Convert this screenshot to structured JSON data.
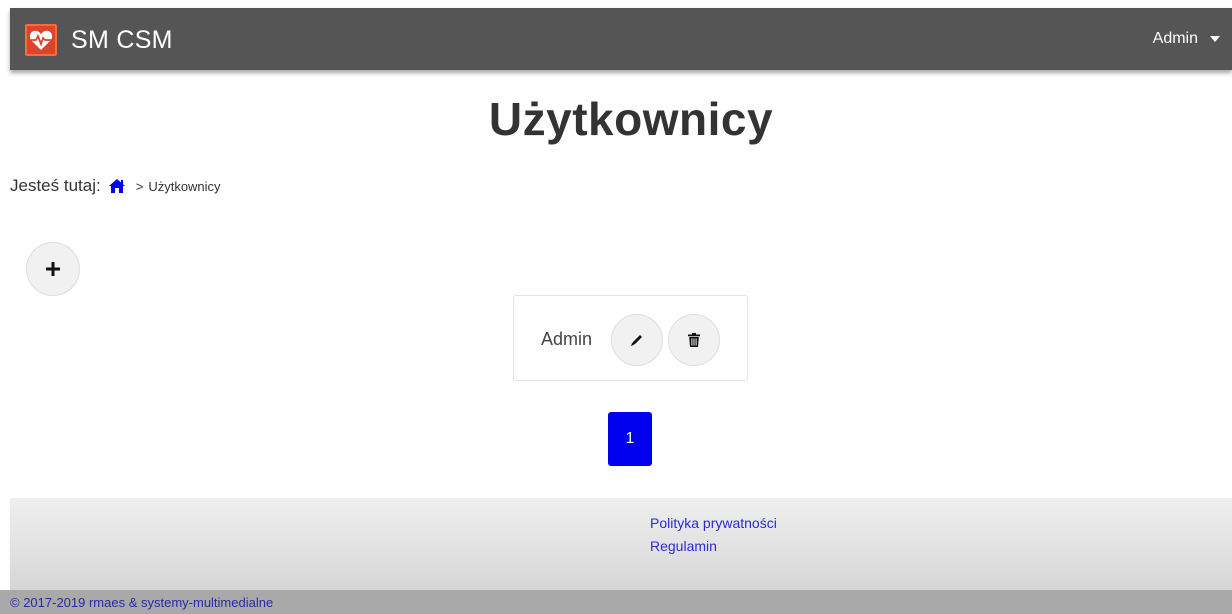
{
  "navbar": {
    "brand_name": "SM CSM",
    "user_label": "Admin",
    "logo_icon": "heart-pulse-icon",
    "colors": {
      "background": "#555555",
      "logo": "#d9462b"
    }
  },
  "page": {
    "title": "Użytkownicy"
  },
  "breadcrumb": {
    "prefix": "Jesteś tutaj:",
    "home_icon": "home-icon",
    "separator": ">",
    "current": "Użytkownicy",
    "colors": {
      "home_icon": "#0000ee"
    }
  },
  "actions": {
    "add_icon": "plus-icon"
  },
  "users": [
    {
      "name": "Admin",
      "edit_icon": "pencil-icon",
      "delete_icon": "trash-icon"
    }
  ],
  "pagination": {
    "pages": [
      "1"
    ],
    "current": "1",
    "colors": {
      "active": "#0000ee"
    }
  },
  "footer": {
    "links": [
      "Polityka prywatności",
      "Regulamin"
    ],
    "copyright": "© 2017-2019 rmaes & systemy-multimedialne"
  }
}
